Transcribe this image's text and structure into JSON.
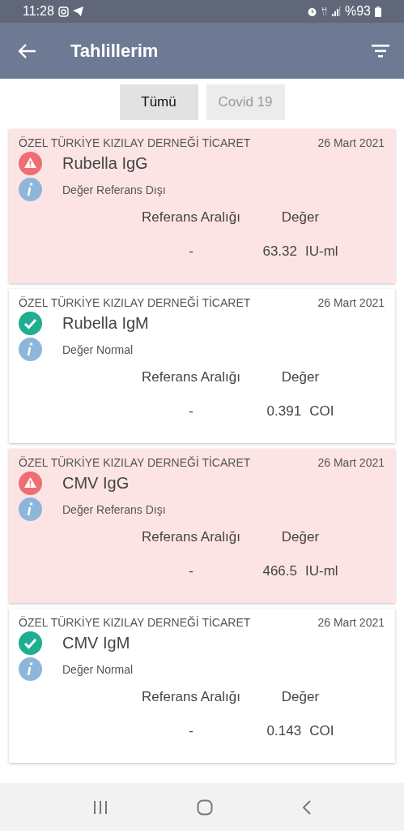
{
  "status_bar": {
    "time": "11:28",
    "battery": "%93"
  },
  "header": {
    "title": "Tahlillerim"
  },
  "tabs": [
    {
      "label": "Tümü",
      "selected": true
    },
    {
      "label": "Covid 19",
      "selected": false
    }
  ],
  "results": [
    {
      "lab": "ÖZEL TÜRKİYE KIZILAY DERNEĞİ TİCARET",
      "date": "26 Mart 2021",
      "test": "Rubella IgG",
      "kind": "abnormal",
      "note": "Değer Referans Dışı",
      "range_label": "Referans Aralığı",
      "value_label": "Değer",
      "range": "-",
      "value": "63.32",
      "unit": "IU-ml"
    },
    {
      "lab": "ÖZEL TÜRKİYE KIZILAY DERNEĞİ TİCARET",
      "date": "26 Mart 2021",
      "test": "Rubella IgM",
      "kind": "normal",
      "note": "Değer Normal",
      "range_label": "Referans Aralığı",
      "value_label": "Değer",
      "range": "-",
      "value": "0.391",
      "unit": "COI"
    },
    {
      "lab": "ÖZEL TÜRKİYE KIZILAY DERNEĞİ TİCARET",
      "date": "26 Mart 2021",
      "test": "CMV IgG",
      "kind": "abnormal",
      "note": "Değer Referans Dışı",
      "range_label": "Referans Aralığı",
      "value_label": "Değer",
      "range": "-",
      "value": "466.5",
      "unit": "IU-ml"
    },
    {
      "lab": "ÖZEL TÜRKİYE KIZILAY DERNEĞİ TİCARET",
      "date": "26 Mart 2021",
      "test": "CMV IgM",
      "kind": "normal",
      "note": "Değer Normal",
      "range_label": "Referans Aralığı",
      "value_label": "Değer",
      "range": "-",
      "value": "0.143",
      "unit": "COI"
    }
  ]
}
